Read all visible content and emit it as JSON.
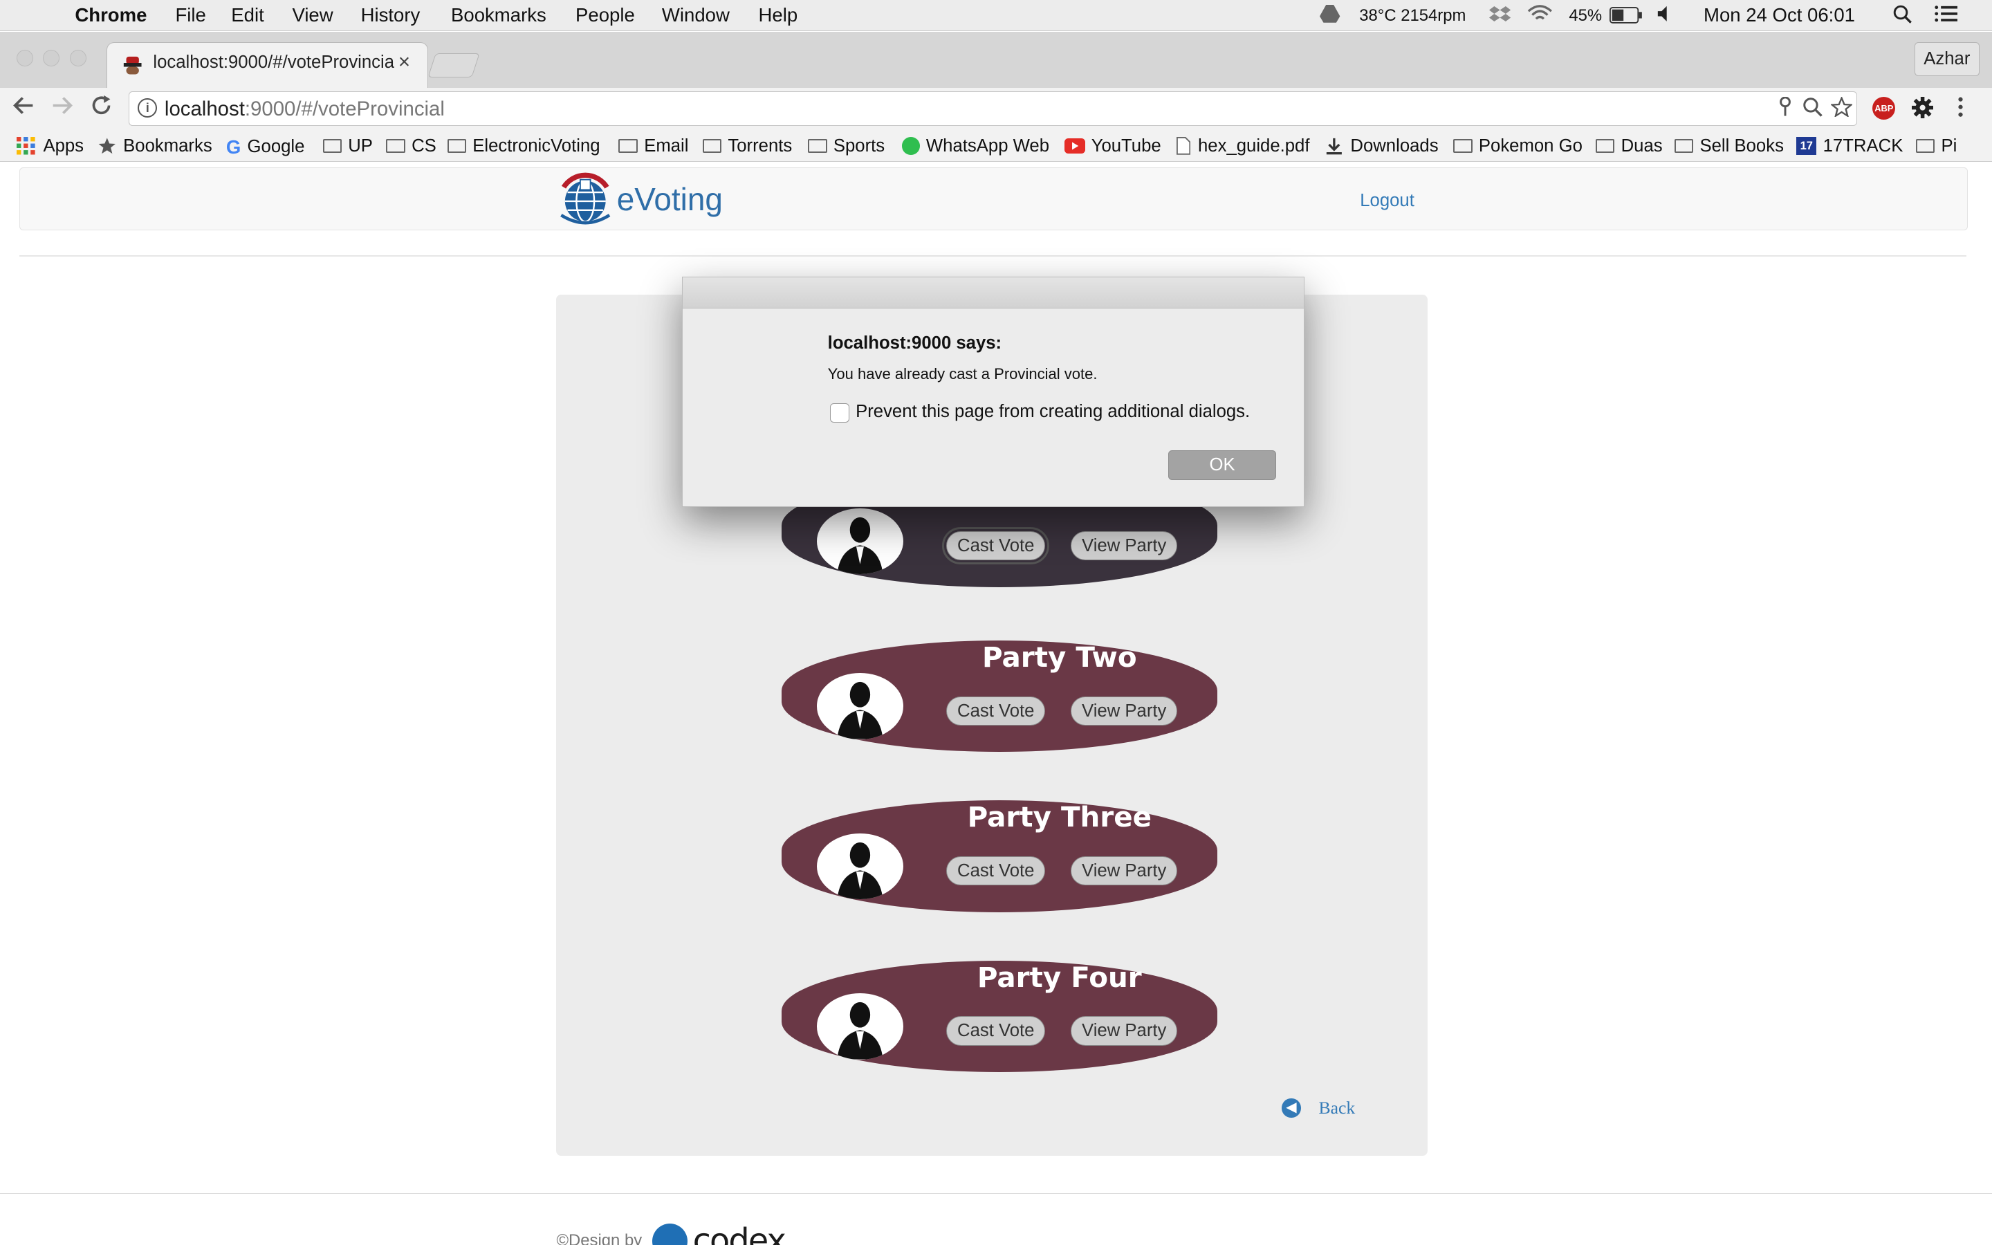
{
  "menubar": {
    "app": "Chrome",
    "items": [
      "File",
      "Edit",
      "View",
      "History",
      "Bookmarks",
      "People",
      "Window",
      "Help"
    ],
    "status": "38°C 2154rpm",
    "battery": "45%",
    "clock": "Mon 24 Oct  06:01"
  },
  "browser": {
    "tab_title": "localhost:9000/#/voteProvincial",
    "profile": "Azhar",
    "url_host": "localhost",
    "url_rest": ":9000/#/voteProvincial",
    "abp": "ABP",
    "bookmarks": [
      {
        "label": "Apps",
        "icon": "apps-grid-icon"
      },
      {
        "label": "Bookmarks",
        "icon": "star-icon"
      },
      {
        "label": "Google",
        "icon": "google-icon"
      },
      {
        "label": "UP",
        "icon": "folder-icon"
      },
      {
        "label": "CS",
        "icon": "folder-icon"
      },
      {
        "label": "ElectronicVoting",
        "icon": "folder-icon"
      },
      {
        "label": "Email",
        "icon": "folder-icon"
      },
      {
        "label": "Torrents",
        "icon": "folder-icon"
      },
      {
        "label": "Sports",
        "icon": "folder-icon"
      },
      {
        "label": "WhatsApp Web",
        "icon": "whatsapp-icon"
      },
      {
        "label": "YouTube",
        "icon": "youtube-icon"
      },
      {
        "label": "hex_guide.pdf",
        "icon": "document-icon"
      },
      {
        "label": "Downloads",
        "icon": "download-icon"
      },
      {
        "label": "Pokemon Go",
        "icon": "folder-icon"
      },
      {
        "label": "Duas",
        "icon": "folder-icon"
      },
      {
        "label": "Sell Books",
        "icon": "folder-icon"
      },
      {
        "label": "17TRACK",
        "icon": "17track-icon"
      },
      {
        "label": "Pi",
        "icon": "folder-icon"
      }
    ]
  },
  "site": {
    "brand": "eVoting",
    "logout": "Logout",
    "parties": [
      {
        "name": "",
        "cast": "Cast Vote",
        "view": "View Party"
      },
      {
        "name": "Party Two",
        "cast": "Cast Vote",
        "view": "View Party"
      },
      {
        "name": "Party Three",
        "cast": "Cast Vote",
        "view": "View Party"
      },
      {
        "name": "Party Four",
        "cast": "Cast Vote",
        "view": "View Party"
      }
    ],
    "back": "Back",
    "footer_text": "©Design by",
    "footer_logo": "codex"
  },
  "dialog": {
    "title": "localhost:9000 says:",
    "message": "You have already cast a Provincial vote.",
    "checkbox_label": "Prevent this page from creating additional dialogs.",
    "ok": "OK"
  },
  "colors": {
    "party_card": "#6a3846",
    "party_card_dimmed": "#3a323d",
    "link": "#337ab7",
    "brand": "#2f6ea8"
  }
}
